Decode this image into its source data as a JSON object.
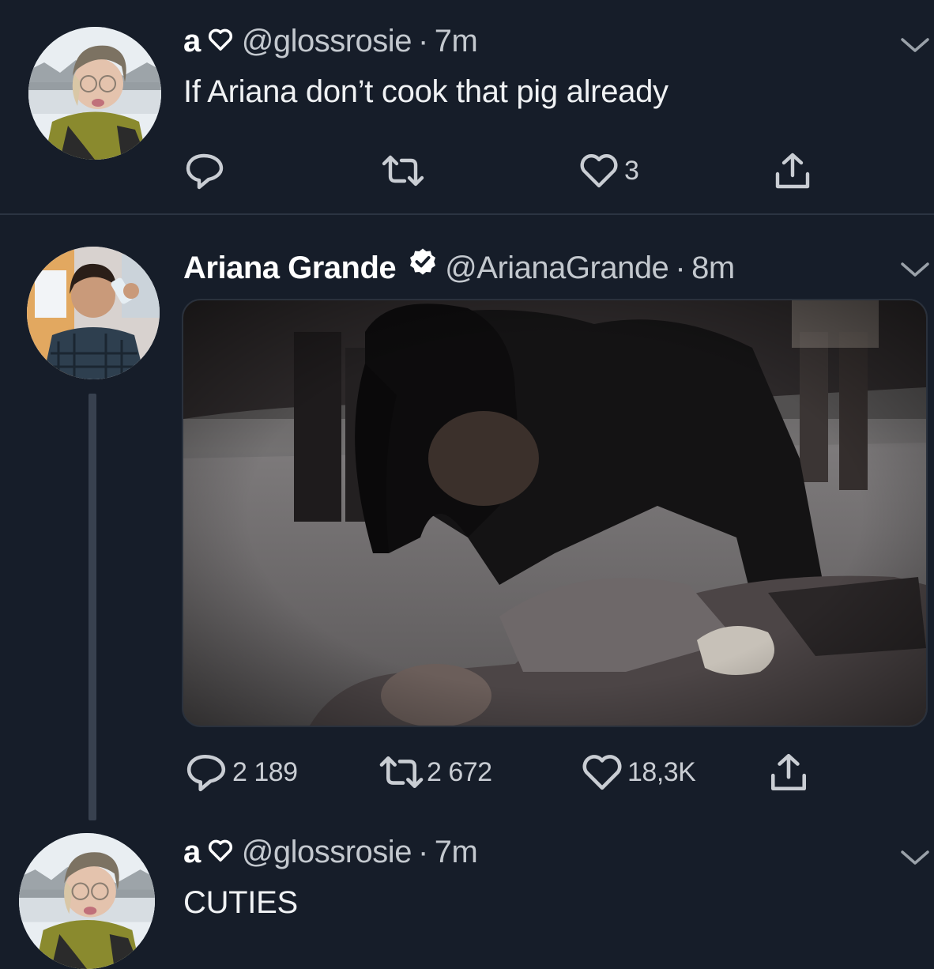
{
  "tweet1": {
    "display_name": "a",
    "handle": "@glossrosie",
    "separator": "·",
    "time": "7m",
    "text": "If Ariana don’t cook that pig already",
    "likes": "3",
    "icons": [
      "reply-icon",
      "retweet-icon",
      "heart-icon",
      "share-icon",
      "chevron-down-icon"
    ]
  },
  "tweet2": {
    "display_name": "Ariana Grande",
    "handle": "@ArianaGrande",
    "separator": "·",
    "time": "8m",
    "verified": true,
    "replies": "2 189",
    "retweets": "2 672",
    "likes": "18,3K",
    "icons": [
      "verified-icon",
      "reply-icon",
      "retweet-icon",
      "heart-icon",
      "share-icon",
      "chevron-down-icon"
    ]
  },
  "tweet3": {
    "display_name": "a",
    "handle": "@glossrosie",
    "separator": "·",
    "time": "7m",
    "text": "CUTIES"
  },
  "colors": {
    "background": "#161d29",
    "text": "#f0f2f4",
    "muted": "#c3c8ce",
    "divider": "#2b3442",
    "verified": "#ffffff"
  }
}
